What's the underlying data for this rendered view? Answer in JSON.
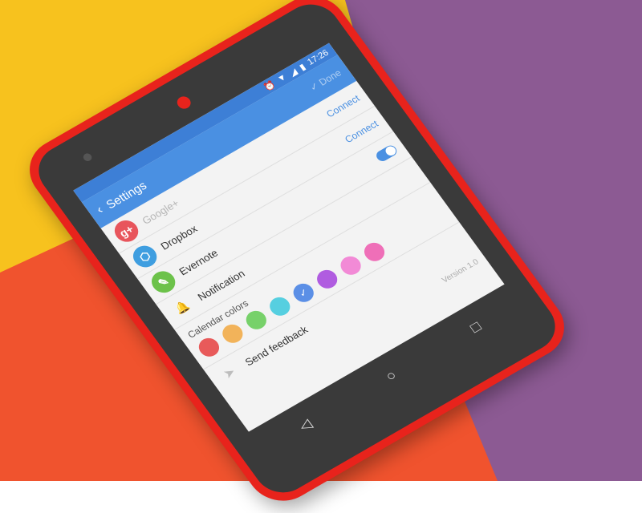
{
  "colors": {
    "bg_yellow": "#f7c21e",
    "bg_purple": "#8c5a93",
    "bg_orange": "#f0532e",
    "accent": "#4a90e2",
    "phone_red": "#e8231c"
  },
  "status_bar": {
    "time": "17:26",
    "icons": [
      "alarm-icon",
      "wifi-icon",
      "signal-icon",
      "battery-icon"
    ]
  },
  "app_bar": {
    "back_icon": "arrow-back-icon",
    "title": "Settings",
    "done_label": "Done"
  },
  "settings": [
    {
      "icon": "google-plus-icon",
      "glyph": "g+",
      "color": "#e8555c",
      "label": "Google+",
      "action": "Connect",
      "muted": true
    },
    {
      "icon": "dropbox-icon",
      "glyph": "⬡",
      "color": "#3f9ee0",
      "label": "Dropbox",
      "action": "Connect",
      "muted": false
    },
    {
      "icon": "evernote-icon",
      "glyph": "✎",
      "color": "#6cc24a",
      "label": "Evernote",
      "toggle": true,
      "muted": false
    },
    {
      "icon": "bell-icon",
      "glyph": "🔔",
      "color": "#cfcfcf",
      "label": "Notification",
      "muted": false
    }
  ],
  "calendar_colors": {
    "title": "Calendar colors",
    "swatches": [
      {
        "color": "#e85a5a"
      },
      {
        "color": "#f2b35a"
      },
      {
        "color": "#77d16a"
      },
      {
        "color": "#56cfe0"
      },
      {
        "color": "#5b8fe6",
        "selected": true
      },
      {
        "color": "#b05ce0"
      },
      {
        "color": "#f28ad6"
      },
      {
        "color": "#ef6fb8"
      }
    ]
  },
  "feedback": {
    "icon": "send-icon",
    "label": "Send feedback"
  },
  "version": "Version 1.0",
  "nav": {
    "back": "◁",
    "home": "○",
    "recents": "□"
  }
}
